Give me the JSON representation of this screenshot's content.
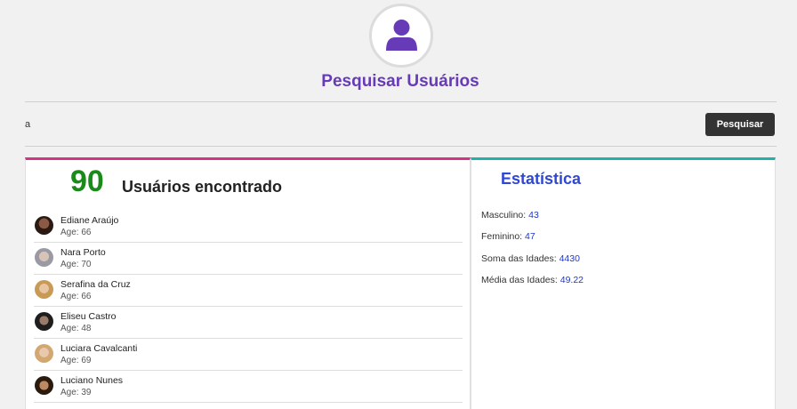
{
  "header": {
    "title": "Pesquisar Usuários",
    "logo_icon": "user-icon",
    "accent": "#673ab7"
  },
  "search": {
    "value": "a",
    "button_label": "Pesquisar"
  },
  "results": {
    "count": "90",
    "count_label": "Usuários encontrado",
    "users": [
      {
        "name": "Ediane Araújo",
        "age": "Age: 66"
      },
      {
        "name": "Nara Porto",
        "age": "Age: 70"
      },
      {
        "name": "Serafina da Cruz",
        "age": "Age: 66"
      },
      {
        "name": "Eliseu Castro",
        "age": "Age: 48"
      },
      {
        "name": "Luciara Cavalcanti",
        "age": "Age: 69"
      },
      {
        "name": "Luciano Nunes",
        "age": "Age: 39"
      }
    ]
  },
  "stats": {
    "title": "Estatística",
    "items": [
      {
        "label": "Masculino: ",
        "value": "43"
      },
      {
        "label": "Feminino: ",
        "value": "47"
      },
      {
        "label": "Soma das Idades: ",
        "value": "4430"
      },
      {
        "label": "Média das Idades: ",
        "value": "49.22"
      }
    ]
  },
  "colors": {
    "count_green": "#1a8a1a",
    "stats_blue": "#3047d6",
    "left_border": "#d63384",
    "right_border": "#20b2aa"
  }
}
